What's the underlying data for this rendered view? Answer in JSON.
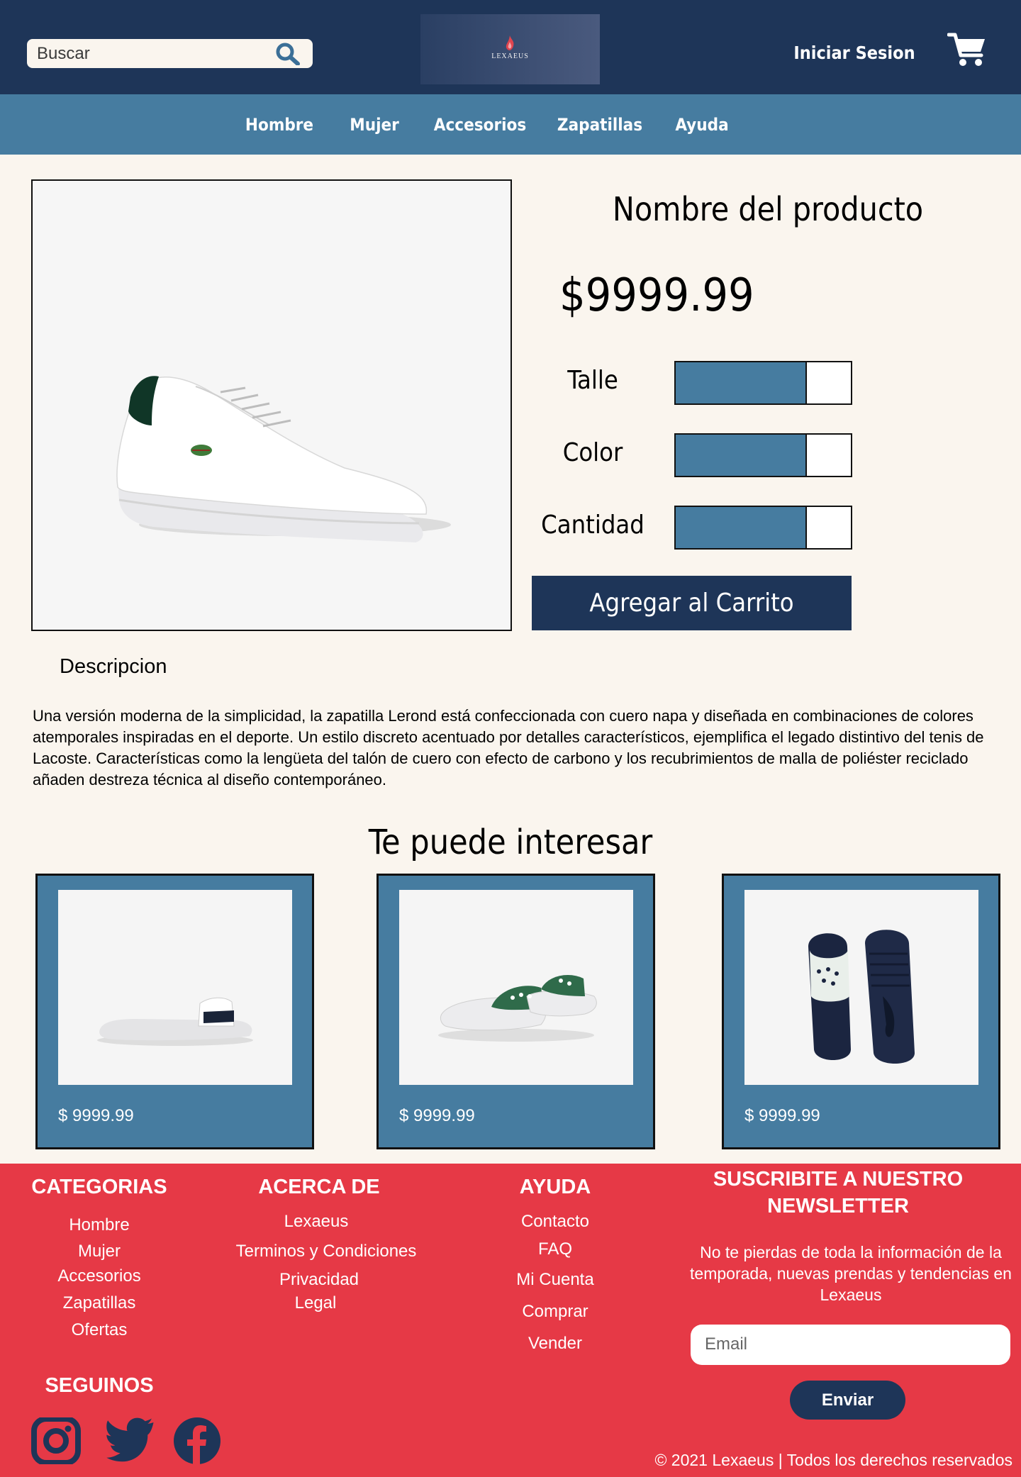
{
  "header": {
    "search_placeholder": "Buscar",
    "logo_text": "LEXAEUS",
    "login_label": "Iniciar Sesion"
  },
  "nav": {
    "items": [
      "Hombre",
      "Mujer",
      "Accesorios",
      "Zapatillas",
      "Ayuda"
    ]
  },
  "product": {
    "name": "Nombre del producto",
    "price": "$9999.99",
    "options": [
      "Talle",
      "Color",
      "Cantidad"
    ],
    "add_to_cart": "Agregar al Carrito",
    "description_title": "Descripcion",
    "description": "Una versión moderna de la simplicidad, la zapatilla Lerond está confeccionada con cuero napa y diseñada en combinaciones de colores atemporales inspiradas en el deporte. Un estilo discreto acentuado por detalles característicos, ejemplifica el legado distintivo del tenis de Lacoste. Características como la lengüeta del talón de cuero con efecto de carbono y los recubrimientos de malla de poliéster reciclado añaden destreza técnica al diseño contemporáneo."
  },
  "related": {
    "title": "Te puede interesar",
    "items": [
      {
        "price": "$ 9999.99"
      },
      {
        "price": "$ 9999.99"
      },
      {
        "price": "$ 9999.99"
      }
    ]
  },
  "footer": {
    "categories": {
      "title": "CATEGORIAS",
      "links": [
        "Hombre",
        "Mujer",
        "Accesorios",
        "Zapatillas",
        "Ofertas"
      ]
    },
    "about": {
      "title": "ACERCA DE",
      "links": [
        "Lexaeus",
        "Terminos y Condiciones",
        "Privacidad",
        "Legal"
      ]
    },
    "help": {
      "title": "AYUDA",
      "links": [
        "Contacto",
        "FAQ",
        "Mi Cuenta",
        "Comprar",
        "Vender"
      ]
    },
    "newsletter": {
      "title_line1": "SUSCRIBITE A NUESTRO",
      "title_line2": "NEWSLETTER",
      "text": "No te pierdas de toda la información de la temporada, nuevas prendas y tendencias en Lexaeus",
      "email_placeholder": "Email",
      "send_label": "Enviar"
    },
    "follow_title": "SEGUINOS",
    "social_icons": [
      "instagram-icon",
      "twitter-icon",
      "facebook-icon"
    ],
    "copyright": "© 2021 Lexaeus | Todos los derechos reservados"
  },
  "colors": {
    "navy": "#1e3558",
    "steel_blue": "#467ca0",
    "red": "#e63946",
    "cream": "#faf5ee"
  }
}
